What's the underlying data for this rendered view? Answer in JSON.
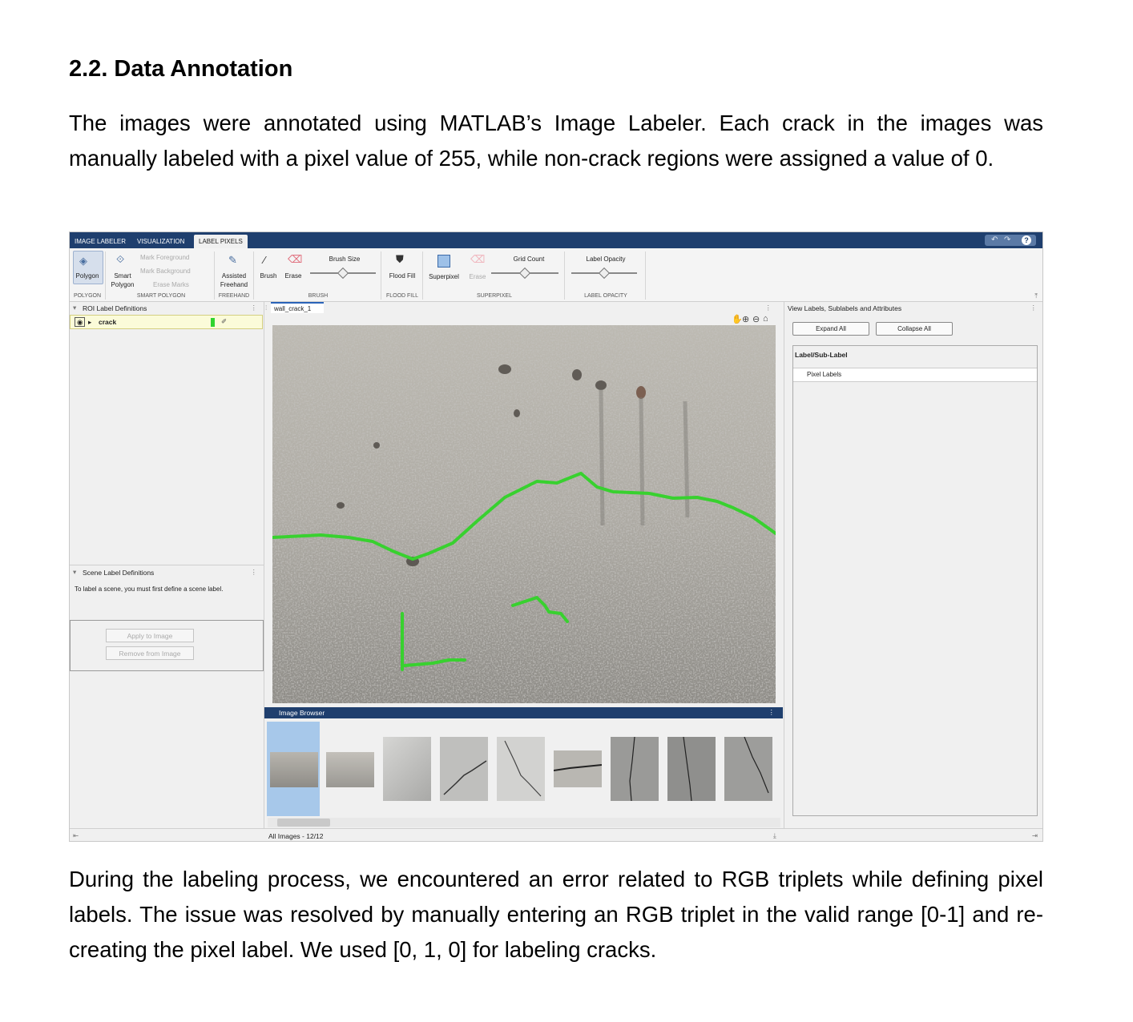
{
  "section_heading": "2.2. Data Annotation",
  "paragraph_intro": "The images were annotated using MATLAB’s Image Labeler. Each crack in the images was manually labeled with a pixel value of 255, while non-crack regions were assigned a value of 0.",
  "paragraph_outro": "During the labeling process, we encountered an error related to RGB triplets while defining pixel labels. The issue was resolved by manually entering an RGB triplet in the valid range [0-1] and re-creating the pixel label. We used [0, 1, 0] for labeling cracks.",
  "app": {
    "tabs": [
      "IMAGE LABELER",
      "VISUALIZATION",
      "LABEL PIXELS"
    ],
    "ribbon": {
      "polygon": "Polygon",
      "smart_polygon_1": "Smart",
      "smart_polygon_2": "Polygon",
      "mark_foreground": "Mark Foreground",
      "mark_background": "Mark Background",
      "erase_marks": "Erase Marks",
      "assisted_1": "Assisted",
      "assisted_2": "Freehand",
      "brush": "Brush",
      "erase": "Erase",
      "brush_size": "Brush Size",
      "flood_fill": "Flood Fill",
      "superpixel": "Superpixel",
      "superpixel_erase": "Erase",
      "grid_count": "Grid Count",
      "label_opacity": "Label Opacity",
      "sections": {
        "polygon": "POLYGON",
        "smart_polygon": "SMART POLYGON",
        "freehand": "FREEHAND",
        "brush": "BRUSH",
        "flood_fill": "FLOOD FILL",
        "superpixel": "SUPERPIXEL",
        "label_opacity": "LABEL OPACITY"
      },
      "brush_size_level": 0.5,
      "grid_count_level": 0.5,
      "label_opacity_level": 0.5
    },
    "left": {
      "roi_title": "ROI Label Definitions",
      "crack_label": "crack",
      "crack_color": "#2fd42f",
      "scene_title": "Scene Label Definitions",
      "scene_hint": "To label a scene, you must first define a scene label.",
      "apply_button": "Apply to Image",
      "remove_button": "Remove from Image"
    },
    "center": {
      "doc_tab": "wall_crack_1",
      "browser_title": "Image Browser",
      "status": "All Images - 12/12"
    },
    "right": {
      "title": "View Labels, Sublabels and Attributes",
      "expand_all": "Expand All",
      "collapse_all": "Collapse All",
      "column_header": "Label/Sub-Label",
      "row_pixel_labels": "Pixel Labels"
    }
  }
}
